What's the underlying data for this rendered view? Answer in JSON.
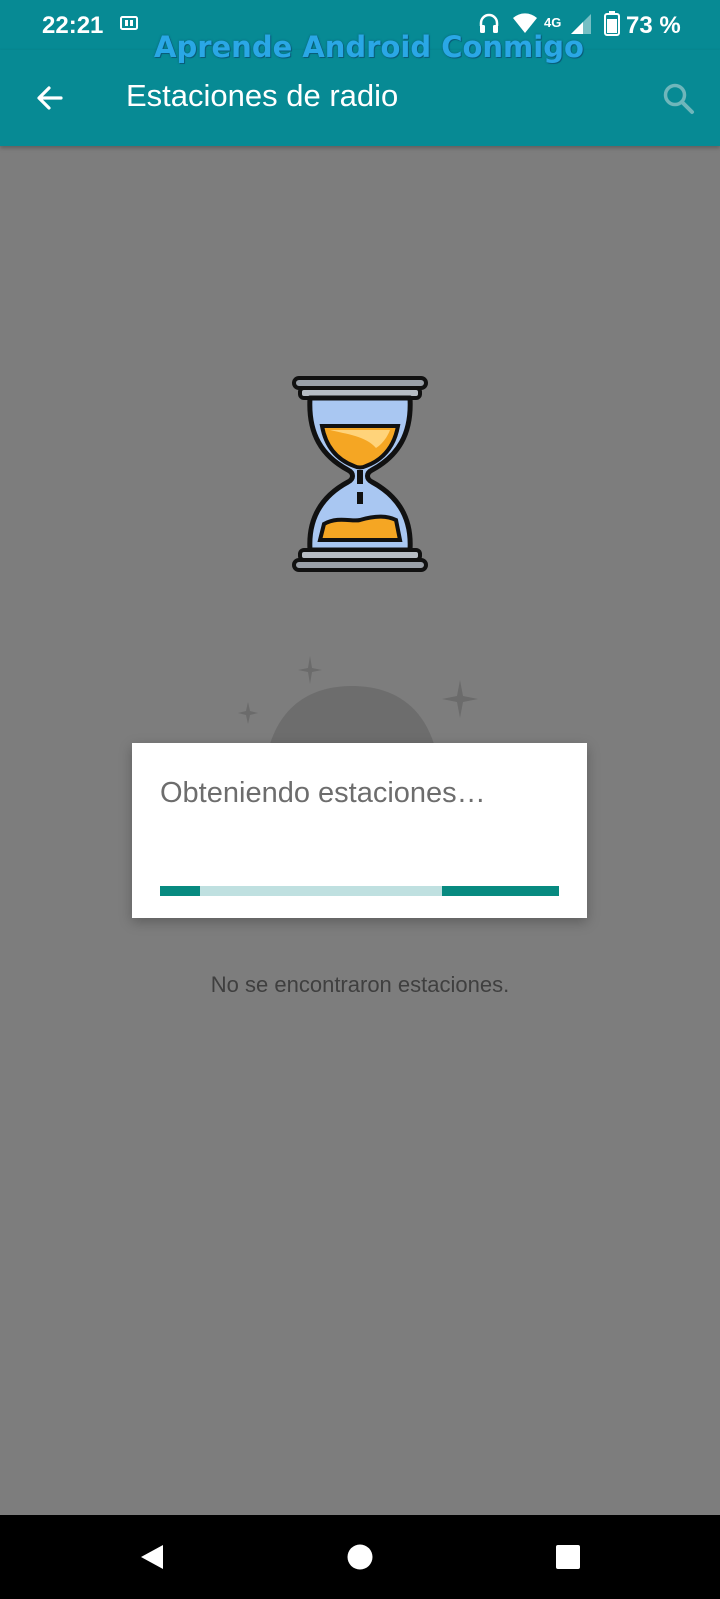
{
  "status_bar": {
    "time": "22:21",
    "network_type": "4G",
    "battery_percent": "73 %",
    "icons": [
      "sim-icon",
      "headphone-icon",
      "wifi-icon",
      "signal-icon",
      "battery-icon"
    ]
  },
  "watermark": {
    "text": "Aprende Android Conmigo"
  },
  "app_bar": {
    "title": "Estaciones de radio",
    "back_icon": "arrow-left-icon",
    "search_icon": "search-icon",
    "color": "#078a94"
  },
  "content": {
    "empty_text": "No se encontraron estaciones.",
    "illustration_icon": "hourglass-icon"
  },
  "dialog": {
    "message": "Obteniendo estaciones…",
    "progress": "indeterminate",
    "progress_color": "#078a80"
  },
  "nav_bar": {
    "icons": [
      "nav-back-icon",
      "nav-home-icon",
      "nav-recents-icon"
    ]
  }
}
